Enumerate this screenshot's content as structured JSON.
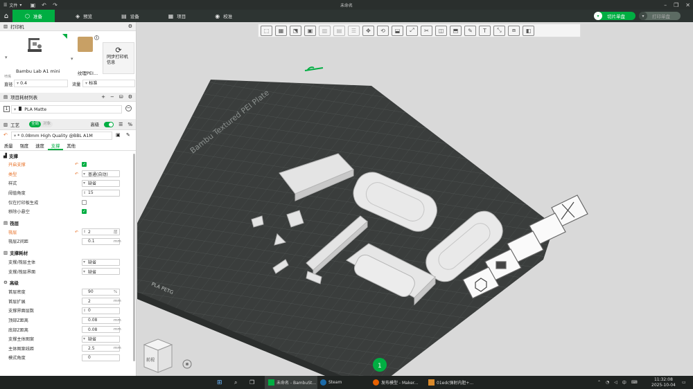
{
  "titlebar": {
    "menu_label": "文件",
    "window_title": "未命名"
  },
  "navbar": {
    "tabs": [
      {
        "label": "准备",
        "icon": "cube-icon"
      },
      {
        "label": "预览",
        "icon": "layers-icon"
      },
      {
        "label": "设备",
        "icon": "device-icon"
      },
      {
        "label": "项目",
        "icon": "project-icon"
      },
      {
        "label": "校准",
        "icon": "calibrate-icon"
      }
    ],
    "slice_button": "切片单盘",
    "print_button": "打印单盘"
  },
  "printer": {
    "section_title": "打印机",
    "printer_name": "Bambu Lab A1 mini",
    "plate_name": "纹理PEI...",
    "sync_label": "同步打印机信息",
    "nozzle_caption": "喷嘴",
    "diameter_label": "直径",
    "diameter_value": "0.4",
    "flow_label": "流量",
    "flow_value": "标准"
  },
  "filaments": {
    "section_title": "项目耗材列表",
    "slot": "1",
    "filament_name": "PLA Matte"
  },
  "process": {
    "section_title": "工艺",
    "global_label": "全局",
    "object_label": "对象",
    "advanced_label": "高级",
    "preset_name": "* 0.08mm High Quality @BBL A1M",
    "tabs": [
      "质量",
      "强度",
      "速度",
      "支撑",
      "其他"
    ]
  },
  "support": {
    "group_title": "支撑",
    "rows": [
      {
        "label": "开启支撑"
      },
      {
        "label": "类型",
        "value": "普通(自动)"
      },
      {
        "label": "样式",
        "value": "缺省"
      },
      {
        "label": "阈值角度",
        "value": "15"
      },
      {
        "label": "仅在打印板生成"
      },
      {
        "label": "移除小悬空"
      }
    ]
  },
  "raft": {
    "group_title": "筏层",
    "rows": [
      {
        "label": "筏层",
        "value": "2",
        "unit": "层"
      },
      {
        "label": "筏层Z间距",
        "value": "0.1",
        "unit": "mm"
      }
    ]
  },
  "support_filament": {
    "group_title": "支撑耗材",
    "rows": [
      {
        "label": "支撑/筏层主体",
        "value": "缺省"
      },
      {
        "label": "支撑/筏层界面",
        "value": "缺省"
      }
    ]
  },
  "advanced": {
    "group_title": "高级",
    "rows": [
      {
        "label": "首层密度",
        "value": "90",
        "unit": "%"
      },
      {
        "label": "首层扩展",
        "value": "2",
        "unit": "mm"
      },
      {
        "label": "支撑界面层数",
        "value": "0"
      },
      {
        "label": "顶部Z距离",
        "value": "0.08",
        "unit": "mm"
      },
      {
        "label": "底部Z距离",
        "value": "0.08",
        "unit": "mm"
      },
      {
        "label": "支撑主体图案",
        "value": "缺省"
      },
      {
        "label": "主体图案线距",
        "value": "2.5",
        "unit": "mm"
      },
      {
        "label": "模式角度",
        "value": "0"
      }
    ]
  },
  "viewport": {
    "plate_label": "Bambu Textured PEI Plate",
    "plate_material": "PLA PETG",
    "view_cube_label": "前视",
    "plate_number": "1"
  },
  "taskbar": {
    "time": "11:32:08",
    "date": "2025-10-04",
    "input_method": "中",
    "apps": [
      {
        "label": "未命名 - BambuSt..."
      },
      {
        "label": "Steam"
      },
      {
        "label": "发布模型 - Maker..."
      },
      {
        "label": "01edc弹射内胆+..."
      }
    ]
  },
  "colors": {
    "accent": "#00ae42",
    "warn": "#e8732a",
    "plate": "#3a3d3c"
  }
}
